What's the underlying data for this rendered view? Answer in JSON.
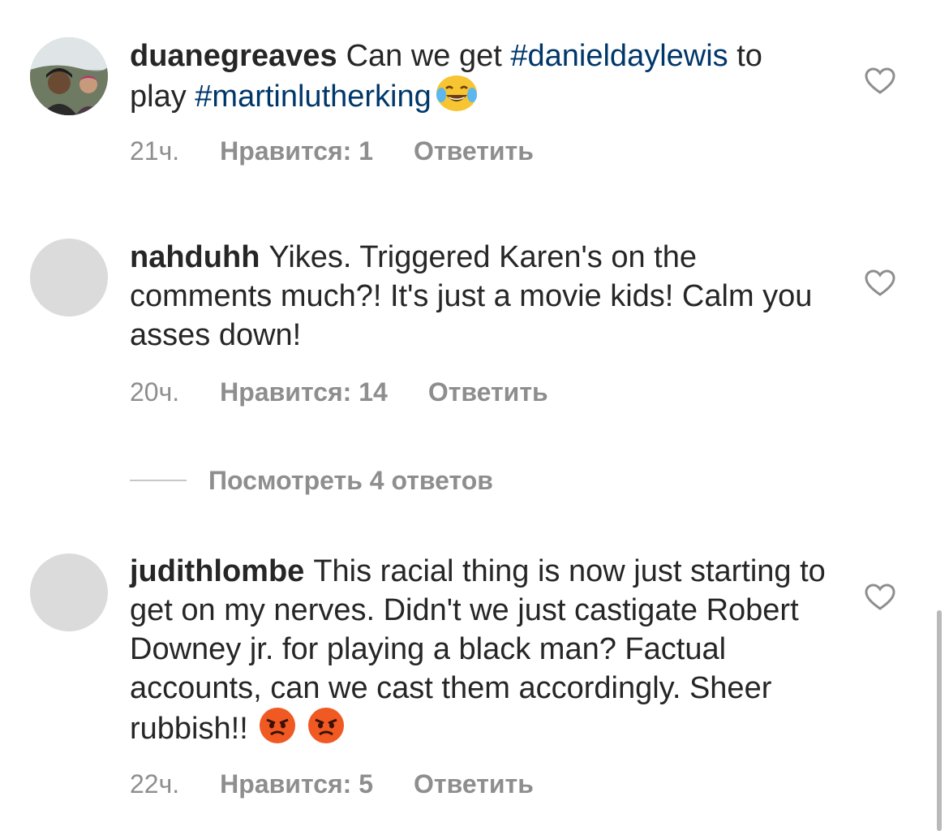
{
  "comments": [
    {
      "username": "duanegreaves",
      "text_parts": [
        "Can we get ",
        "#danieldaylewis",
        " to play ",
        "#martinlutherking"
      ],
      "emoji": [
        "face-with-tears-of-joy"
      ],
      "time": "21ч.",
      "likes": "Нравится: 1",
      "reply": "Ответить",
      "avatar": "photo"
    },
    {
      "username": "nahduhh",
      "text": "Yikes. Triggered Karen's on the comments much?! It's just a movie kids! Calm you asses down!",
      "time": "20ч.",
      "likes": "Нравится: 14",
      "reply": "Ответить",
      "avatar": "placeholder",
      "view_replies": "Посмотреть 4 ответов"
    },
    {
      "username": "judithlombe",
      "text": "This racial thing is now just starting to get on my nerves. Didn't we just castigate Robert Downey jr. for playing a black man? Factual accounts, can we cast them accordingly. Sheer  rubbish!!",
      "emoji": [
        "angry-face",
        "angry-face"
      ],
      "time": "22ч.",
      "likes": "Нравится: 5",
      "reply": "Ответить",
      "avatar": "placeholder"
    }
  ],
  "colors": {
    "text": "#262626",
    "hashtag": "#00376b",
    "meta": "#8e8e8e",
    "avatar_placeholder": "#dbdbdb"
  },
  "icons": [
    "heart-outline-icon",
    "face-with-tears-of-joy-emoji",
    "angry-face-emoji"
  ]
}
